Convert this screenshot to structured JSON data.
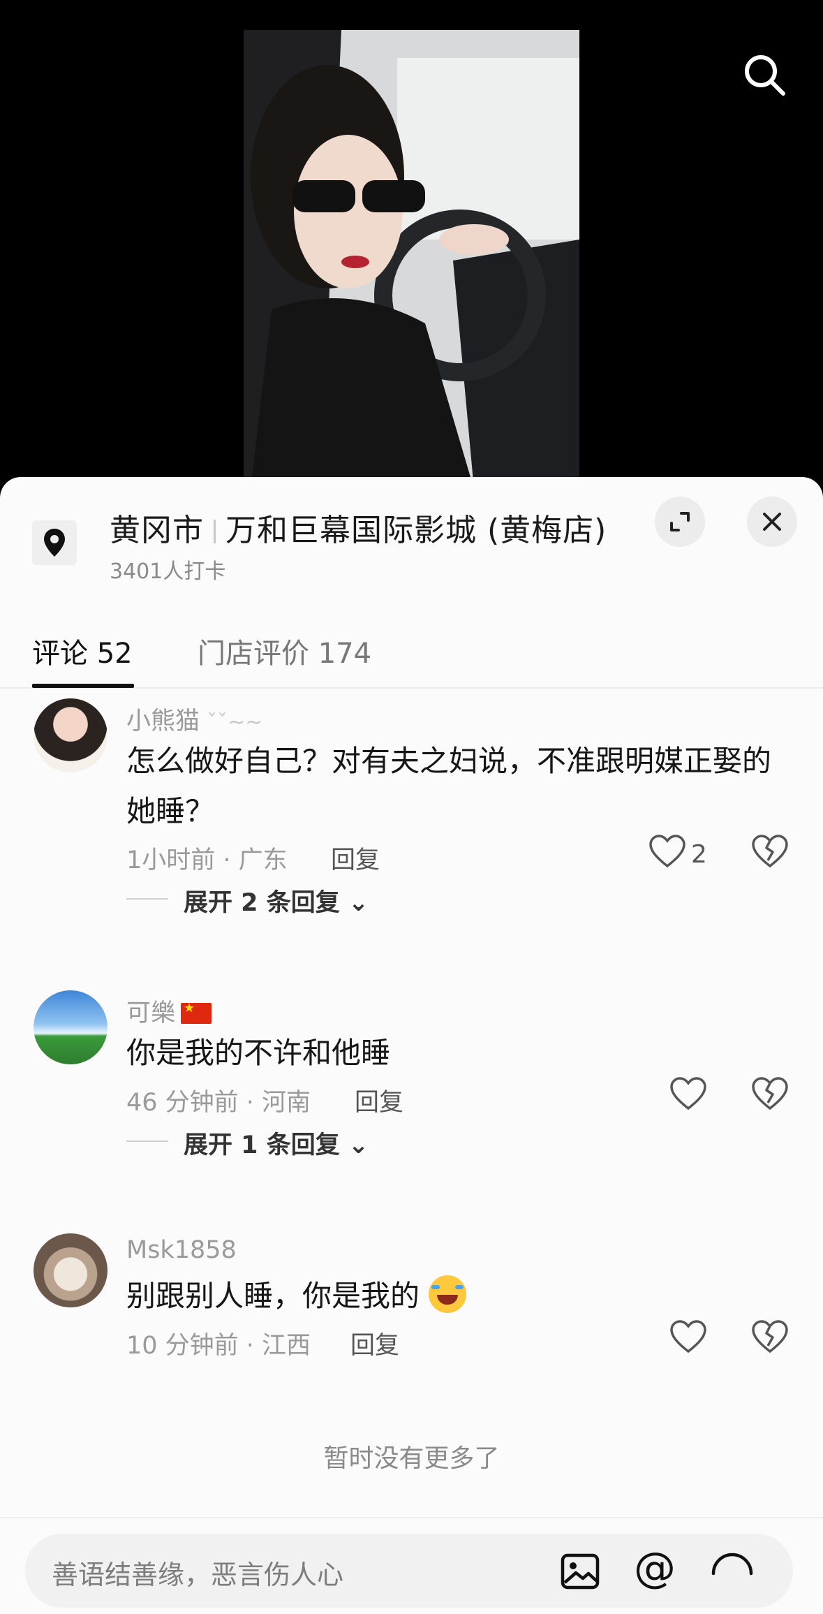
{
  "location": {
    "city": "黄冈市",
    "venue": "万和巨幕国际影城 (黄梅店)",
    "checkins": "3401人打卡"
  },
  "tabs": {
    "comments": "评论 52",
    "reviews": "门店评价 174"
  },
  "comments": [
    {
      "username": "小熊猫",
      "text": "怎么做好自己？对有夫之妇说，不准跟明媒正娶的她睡？",
      "meta": "1小时前 · 广东",
      "reply": "回复",
      "likes": "2",
      "expand": "展开 2 条回复"
    },
    {
      "username": "可樂",
      "text": "你是我的不许和他睡",
      "meta": "46 分钟前 · 河南",
      "reply": "回复",
      "expand": "展开 1 条回复"
    },
    {
      "username": "Msk1858",
      "text": "别跟别人睡，你是我的",
      "meta": "10 分钟前 · 江西",
      "reply": "回复"
    }
  ],
  "no_more": "暂时没有更多了",
  "input": {
    "placeholder": "善语结善缘，恶言伤人心"
  },
  "icons": {
    "at": "@"
  }
}
